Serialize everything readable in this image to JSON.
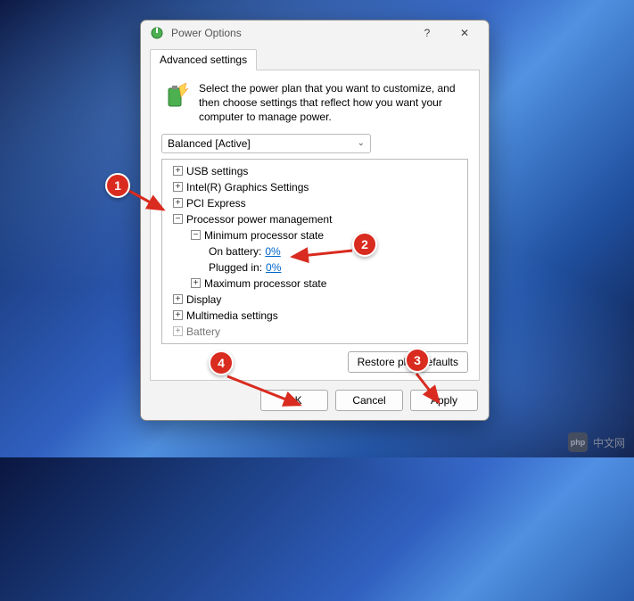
{
  "window": {
    "title": "Power Options",
    "help_tooltip": "?",
    "close_tooltip": "✕"
  },
  "tab": {
    "label": "Advanced settings"
  },
  "intro": "Select the power plan that you want to customize, and then choose settings that reflect how you want your computer to manage power.",
  "plan": {
    "selected": "Balanced [Active]"
  },
  "tree": {
    "usb": "USB settings",
    "graphics": "Intel(R) Graphics Settings",
    "pci": "PCI Express",
    "ppm": "Processor power management",
    "min_state": "Minimum processor state",
    "on_battery": "On battery:",
    "on_battery_val": "0%",
    "plugged_in": "Plugged in:",
    "plugged_in_val": "0%",
    "max_state": "Maximum processor state",
    "display": "Display",
    "multimedia": "Multimedia settings",
    "battery": "Battery"
  },
  "buttons": {
    "restore": "Restore plan defaults",
    "ok": "OK",
    "cancel": "Cancel",
    "apply": "Apply"
  },
  "annotations": {
    "a1": "1",
    "a2": "2",
    "a3": "3",
    "a4": "4"
  },
  "watermark": {
    "logo": "php",
    "text": "中文网"
  }
}
